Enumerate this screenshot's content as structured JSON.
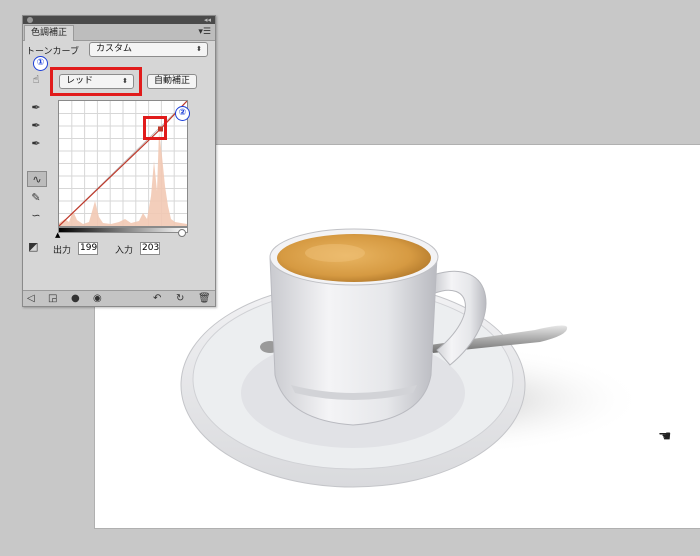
{
  "panel": {
    "tab_label": "色調補正",
    "menu_icon": "panel-menu-icon",
    "tone_label": "トーンカーブ",
    "preset_value": "カスタム",
    "channel_value": "レッド",
    "auto_label": "自動補正",
    "output_label": "出力",
    "output_value": "199",
    "input_label": "入力",
    "input_value": "203"
  },
  "callouts": {
    "one": "①",
    "two": "②"
  },
  "colors": {
    "callout_red": "#e11b1b",
    "callout_blue": "#1c3fd8",
    "histogram": "#f2c9b4",
    "curve": "#c0392b"
  },
  "curve_points": {
    "input": 203,
    "output": 199
  }
}
